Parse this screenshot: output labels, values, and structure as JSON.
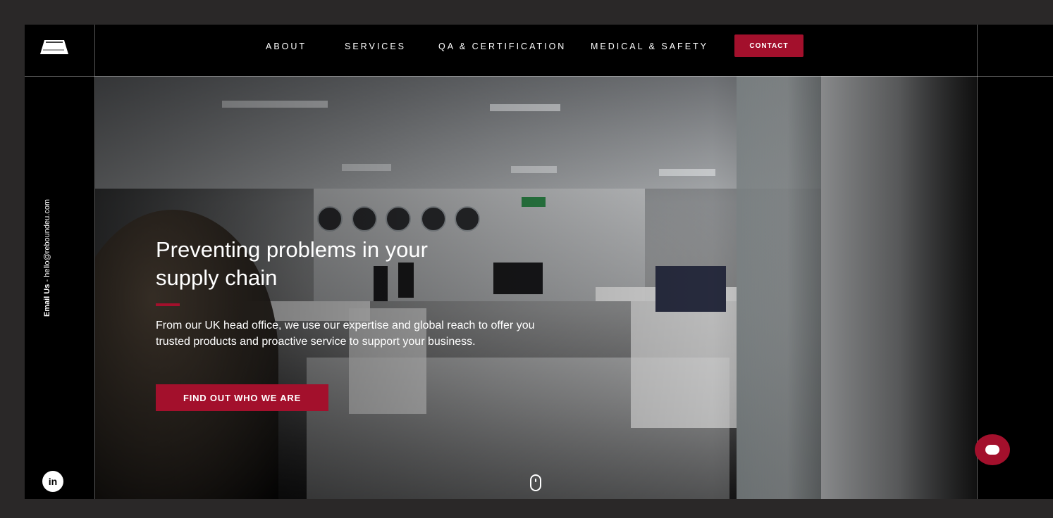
{
  "nav": {
    "items": [
      {
        "label": "ABOUT"
      },
      {
        "label": "SERVICES"
      },
      {
        "label": "QA & CERTIFICATION"
      },
      {
        "label": "MEDICAL & SAFETY"
      }
    ],
    "contact_label": "CONTACT"
  },
  "hero": {
    "headline": "Preventing problems in your supply chain",
    "subtext": "From our UK head office, we use our expertise and global reach to offer you trusted products and proactive service to support your business.",
    "cta_label": "FIND OUT WHO WE ARE"
  },
  "side": {
    "email_label": "Email Us",
    "email_separator": " - ",
    "email_address": "hello@reboundeu.com",
    "linkedin_label": "in"
  },
  "icons": {
    "logo": "brand-logo-icon",
    "scroll": "mouse-scroll-icon",
    "chat": "chat-bubble-icon",
    "linkedin": "linkedin-icon"
  },
  "colors": {
    "accent": "#a3102c",
    "background": "#000000",
    "outer": "#2a2828"
  }
}
